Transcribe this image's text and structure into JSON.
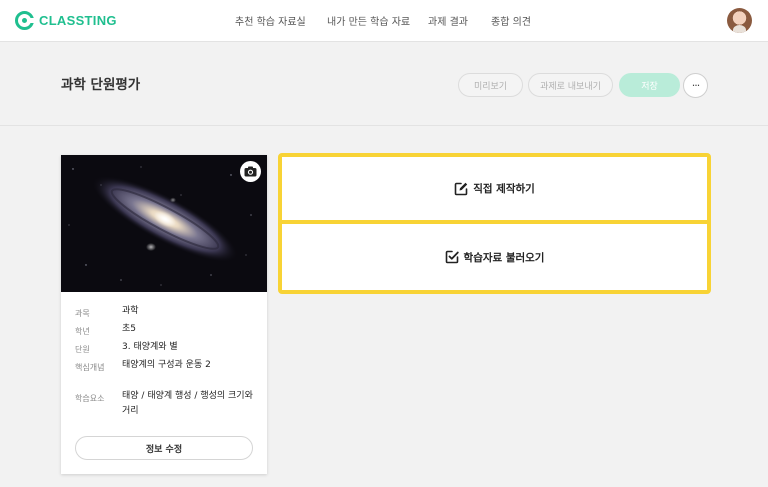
{
  "app": {
    "logo_text": "CLASSTING",
    "brand_color": "#1fbf8f",
    "accent_yellow": "#f8d335"
  },
  "nav": [
    {
      "label": "추천 학습 자료실"
    },
    {
      "label": "내가 만든 학습 자료"
    },
    {
      "label": "과제 결과"
    },
    {
      "label": "종합 의견"
    }
  ],
  "header": {
    "title": "과학 단원평가",
    "preview_label": "미리보기",
    "export_label": "과제로 내보내기",
    "save_label": "저장",
    "more_label": "···"
  },
  "info": {
    "rows": [
      {
        "key": "과목",
        "value": "과학"
      },
      {
        "key": "학년",
        "value": "초5"
      },
      {
        "key": "단원",
        "value": "3. 태양계와 별"
      },
      {
        "key": "핵심개념",
        "value": "태양계의 구성과 운동 2"
      },
      {
        "key": "학습요소",
        "value": "태양 / 태양계 행성 / 행성의 크기와 거리"
      }
    ],
    "edit_label": "정보 수정"
  },
  "options": {
    "create_label": "직접 제작하기",
    "import_label": "학습자료 불러오기"
  }
}
